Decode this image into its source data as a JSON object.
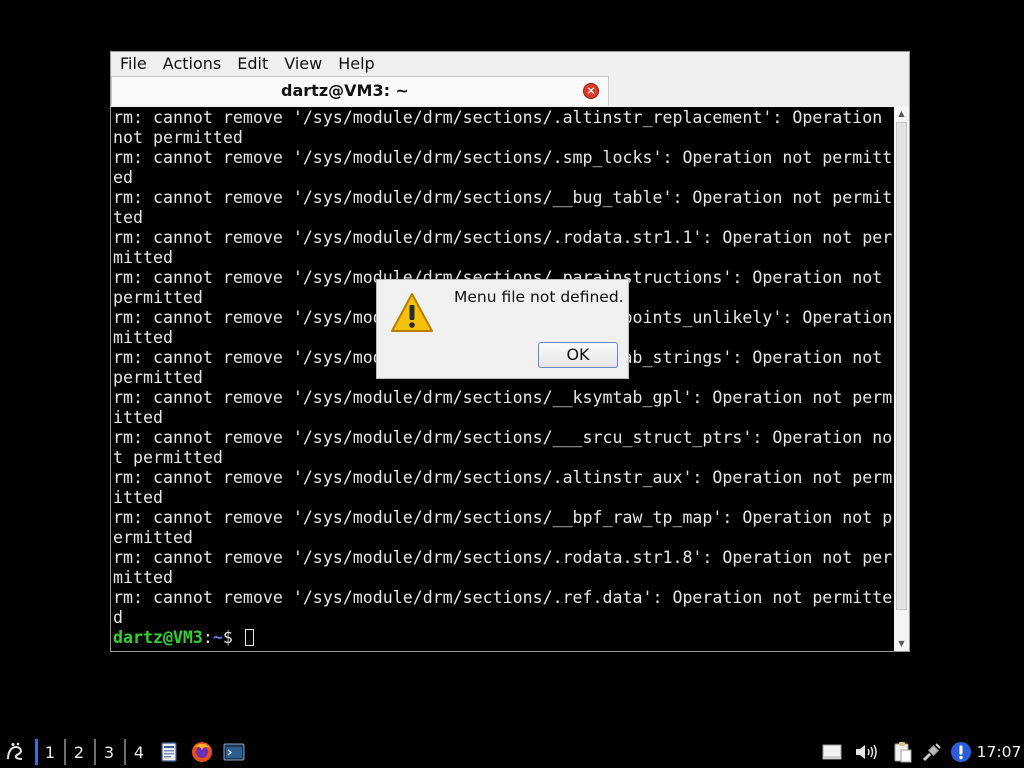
{
  "window": {
    "menu": [
      "File",
      "Actions",
      "Edit",
      "View",
      "Help"
    ],
    "tab_title": "dartz@VM3: ~",
    "tab_close_icon": "close-icon"
  },
  "terminal": {
    "lines": [
      "rm: cannot remove '/sys/module/drm/sections/.altinstr_replacement': Operation",
      "not permitted",
      "rm: cannot remove '/sys/module/drm/sections/.smp_locks': Operation not permitt",
      "ed",
      "rm: cannot remove '/sys/module/drm/sections/__bug_table': Operation not permit",
      "ted",
      "rm: cannot remove '/sys/module/drm/sections/.rodata.str1.1': Operation not per",
      "mitted",
      "rm: cannot remove '/sys/module/drm/sections/.parainstructions': Operation not",
      "permitted",
      "rm: cannot remove '/sys/module/drm/sections/__tracepoints_unlikely': Operation not per",
      "mitted",
      "rm: cannot remove '/sys/module/drm/sections/__ksymtab_strings': Operation not",
      "permitted",
      "rm: cannot remove '/sys/module/drm/sections/__ksymtab_gpl': Operation not perm",
      "itted",
      "rm: cannot remove '/sys/module/drm/sections/___srcu_struct_ptrs': Operation no",
      "t permitted",
      "rm: cannot remove '/sys/module/drm/sections/.altinstr_aux': Operation not perm",
      "itted",
      "rm: cannot remove '/sys/module/drm/sections/__bpf_raw_tp_map': Operation not p",
      "ermitted",
      "rm: cannot remove '/sys/module/drm/sections/.rodata.str1.8': Operation not per",
      "mitted",
      "rm: cannot remove '/sys/module/drm/sections/.ref.data': Operation not permitte",
      "d"
    ],
    "prompt_user": "dartz@VM3",
    "prompt_sep": ":",
    "prompt_dir": "~",
    "prompt_symbol": "$ "
  },
  "dialog": {
    "message": "Menu file not defined.",
    "ok_label": "OK",
    "icon": "warning-icon"
  },
  "taskbar": {
    "workspaces": [
      "1",
      "2",
      "3",
      "4"
    ],
    "active_workspace": "1",
    "launchers": [
      "file-manager-icon",
      "firefox-icon",
      "terminal-icon"
    ],
    "tray": [
      "notes-icon",
      "volume-icon",
      "clipboard-icon",
      "network-icon",
      "updates-icon"
    ],
    "clock": "17:07"
  }
}
